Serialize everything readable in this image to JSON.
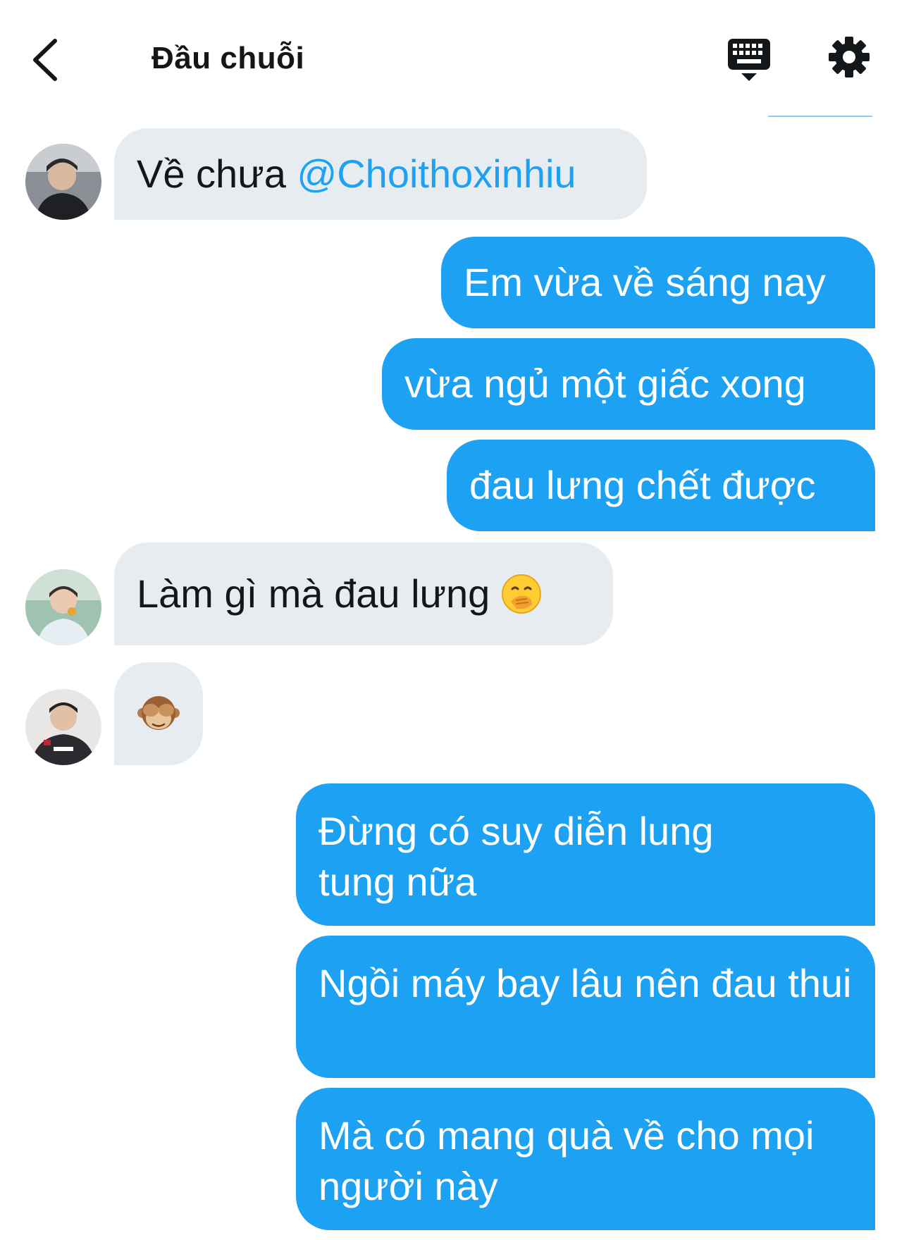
{
  "header": {
    "title": "Đầu chuỗi"
  },
  "icons": {
    "back": "chevron-left-icon",
    "keyboard": "keyboard-icon",
    "settings": "gear-icon"
  },
  "colors": {
    "accent": "#1da1f2",
    "incoming_bubble": "#e6ecf0",
    "text": "#14171a"
  },
  "messages": [
    {
      "direction": "incoming",
      "text": "Về chưa ",
      "mention": "@Choithoxinhiu"
    },
    {
      "direction": "outgoing",
      "text": "Em vừa về sáng nay"
    },
    {
      "direction": "outgoing",
      "text": "vừa ngủ một giấc xong"
    },
    {
      "direction": "outgoing",
      "text": "đau lưng chết được"
    },
    {
      "direction": "incoming",
      "text": "Làm gì mà đau lưng ",
      "emoji": "face-with-hand-over-mouth"
    },
    {
      "direction": "incoming",
      "emoji": "see-no-evil-monkey"
    },
    {
      "direction": "outgoing",
      "text": "Đừng có suy diễn lung tung nữa"
    },
    {
      "direction": "outgoing",
      "text": "Ngồi máy bay lâu nên đau thui"
    },
    {
      "direction": "outgoing",
      "text": "Mà có mang quà về cho mọi người này"
    }
  ]
}
